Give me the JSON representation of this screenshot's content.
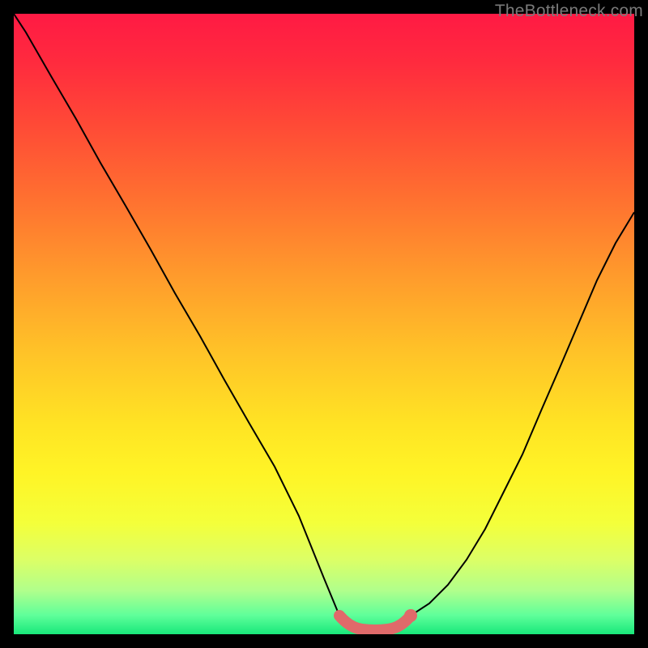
{
  "watermark": "TheBottleneck.com",
  "chart_data": {
    "type": "line",
    "title": "",
    "xlabel": "",
    "ylabel": "",
    "xlim": [
      0,
      100
    ],
    "ylim": [
      0,
      100
    ],
    "grid": false,
    "series": [
      {
        "name": "left-curve",
        "x": [
          0,
          2,
          6,
          10,
          14,
          18,
          22,
          26,
          30,
          34,
          38,
          42,
          46,
          50,
          52.5
        ],
        "values": [
          100,
          97,
          90,
          83,
          76,
          69,
          62,
          55,
          48,
          41,
          34,
          27,
          19,
          9,
          3
        ]
      },
      {
        "name": "right-curve",
        "x": [
          64,
          67,
          70,
          73,
          76,
          79,
          82,
          85,
          88,
          91,
          94,
          97,
          100
        ],
        "values": [
          3,
          5,
          8,
          12,
          17,
          23,
          29,
          36,
          43,
          50,
          57,
          63,
          68
        ]
      },
      {
        "name": "highlight-segment",
        "x": [
          52.5,
          54,
          56,
          58,
          60,
          62,
          64
        ],
        "values": [
          3,
          1.2,
          0.6,
          0.5,
          0.6,
          1.2,
          3
        ]
      }
    ],
    "annotations": [
      {
        "name": "highlight-dot",
        "x": 64,
        "y": 3
      }
    ],
    "colors": {
      "highlight": "#e06a6a",
      "curve": "#000000",
      "gradient_top": "#ff1a44",
      "gradient_bottom": "#18e87a"
    }
  }
}
